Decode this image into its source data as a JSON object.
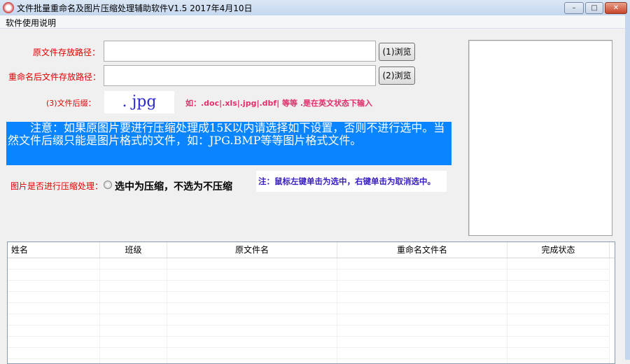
{
  "window": {
    "title": "文件批量重命名及图片压缩处理辅助软件V1.5  2017年4月10日",
    "minimize": "–",
    "maximize": "□",
    "close": "✕"
  },
  "menu": {
    "help": "软件使用说明"
  },
  "form": {
    "source_label": "原文件存放路径：",
    "source_value": "",
    "browse1": "(1)浏览",
    "target_label": "重命名后文件存放路径：",
    "target_value": "",
    "browse2": "(2)浏览",
    "suffix_label": "(3)文件后缀：",
    "suffix_value": ". jpg",
    "suffix_hint": "如：.doc|.xls|.jpg|.dbf|  等等  .是在英文状态下输入"
  },
  "notice": "　　注意：如果原图片要进行压缩处理成15K以内请选择如下设置，否则不进行选中。当然文件后缀只能是图片格式的文件，如：JPG.BMP等等图片格式文件。",
  "compress": {
    "label": "图片是否进行压缩处理：",
    "option": "选中为压缩，不选为不压缩",
    "checked": false,
    "hint": "注：鼠标左键单击为选中，右键单击为取消选中。"
  },
  "table": {
    "columns": [
      "姓名",
      "班级",
      "原文件名",
      "重命名文件名",
      "完成状态"
    ],
    "rows": []
  }
}
